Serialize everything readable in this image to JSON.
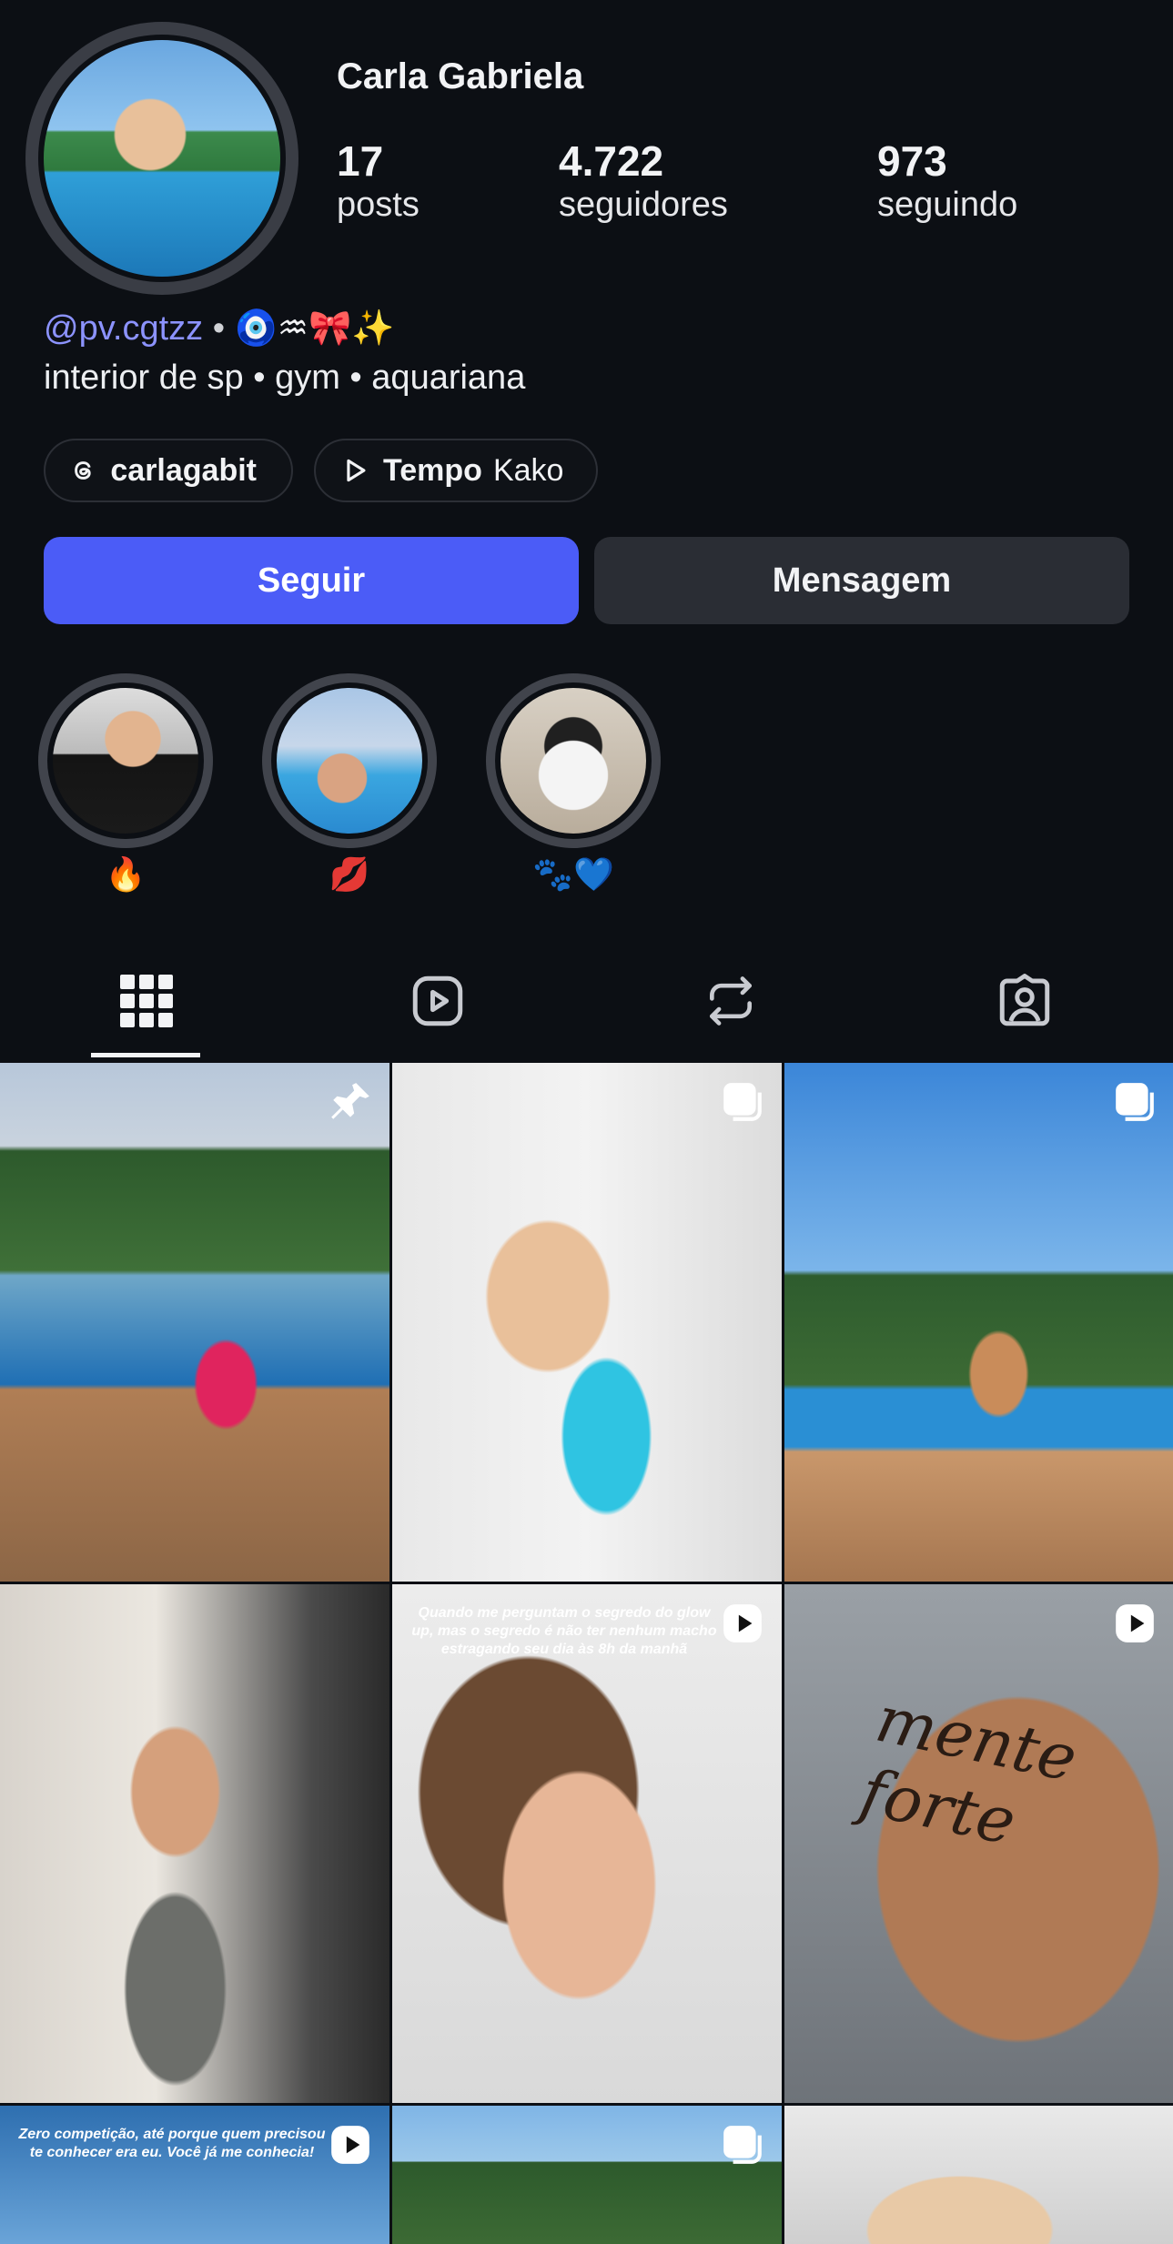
{
  "profile": {
    "display_name": "Carla Gabriela",
    "stats": [
      {
        "value": "17",
        "label": "posts"
      },
      {
        "value": "4.722",
        "label": "seguidores"
      },
      {
        "value": "973",
        "label": "seguindo"
      }
    ],
    "handle": "@pv.cgtzz",
    "bio_emojis": "🧿♒🎀✨",
    "bio_line2": "interior de sp • gym • aquariana",
    "threads_username": "carlagabit",
    "music": {
      "title": "Tempo",
      "artist": "Kako"
    }
  },
  "actions": {
    "follow": "Seguir",
    "message": "Mensagem"
  },
  "highlights": [
    {
      "label": "🔥"
    },
    {
      "label": "💋"
    },
    {
      "label": "🐾💙"
    }
  ],
  "tabs": [
    "grid",
    "reels",
    "reposts",
    "tagged"
  ],
  "grid_captions": {
    "post5": "Quando me perguntam o segredo do glow up, mas o segredo é não ter nenhum macho estragando seu dia às 8h da manhã",
    "post6_tattoo": "mente forte",
    "post7": "Zero competição, até porque quem precisou te conhecer era eu. Você já me conhecia!"
  },
  "colors": {
    "accent": "#4b5cf7",
    "background": "#0c0f14",
    "link": "#8c93ff"
  }
}
